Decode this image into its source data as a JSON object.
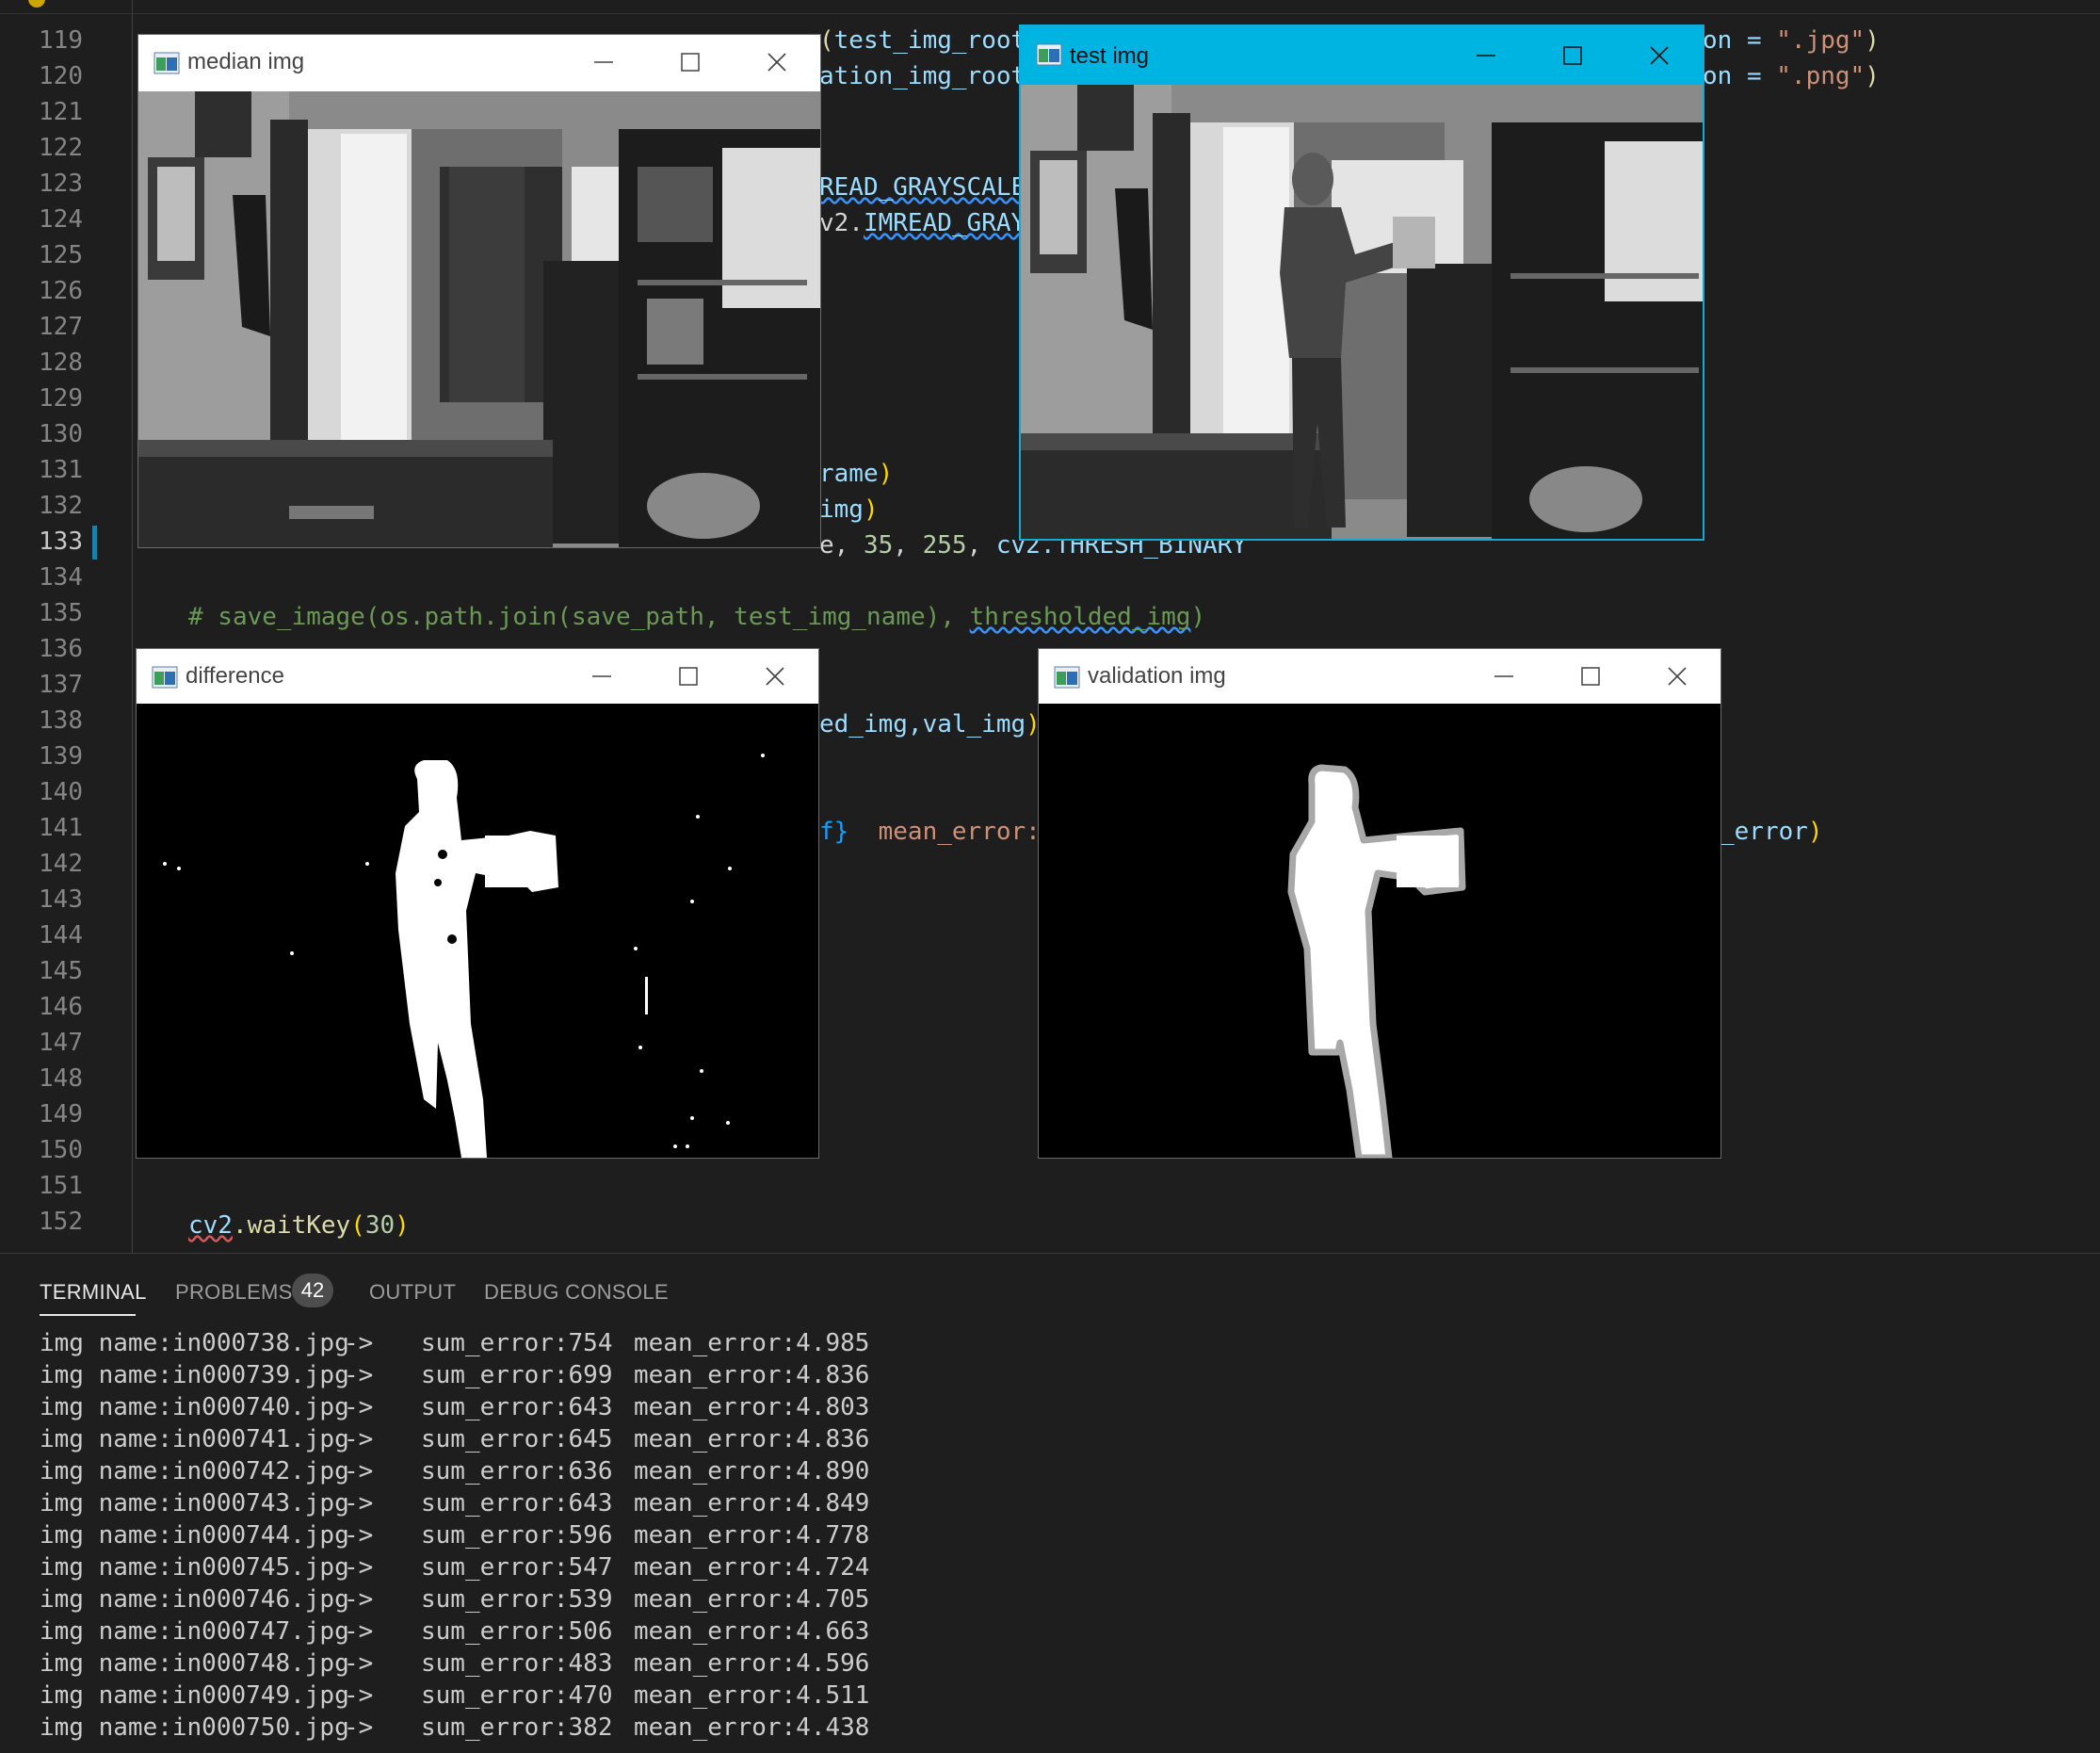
{
  "editor": {
    "line_numbers": [
      "119",
      "120",
      "121",
      "122",
      "123",
      "124",
      "125",
      "126",
      "127",
      "128",
      "129",
      "130",
      "131",
      "132",
      "133",
      "134",
      "135",
      "136",
      "137",
      "138",
      "139",
      "140",
      "141",
      "142",
      "143",
      "144",
      "145",
      "146",
      "147",
      "148",
      "149",
      "150",
      "151",
      "152"
    ],
    "active_line": "133",
    "fragments": {
      "l119a": "test_img_root",
      "l119b": "on = ",
      "l119c": "\".jpg\"",
      "l120a": "ation_img_root",
      "l120b": "on = ",
      "l120c": "\".png\"",
      "l123": "READ_GRAYSCALE",
      "l124a": "v2.",
      "l124b": "IMREAD_GRAY",
      "l131": "rame",
      "l132": "img",
      "l133a": "e, ",
      "l133b": "35",
      "l133c": "255",
      "l133d": "cv2.THRESH_BINARY",
      "l135_comment": "# save_image(os.path.join(save_path, test_img_name), ",
      "l135_var": "thresholded_img",
      "l138": "ed_img,val_img",
      "l141a": "f}",
      "l141b": "mean_error:",
      "l141c": "_error",
      "l152a": "cv2",
      "l152b": ".waitKey",
      "l152c": "30"
    }
  },
  "windows": {
    "median": {
      "title": "median img"
    },
    "test": {
      "title": "test img"
    },
    "difference": {
      "title": "difference"
    },
    "validation": {
      "title": "validation img"
    }
  },
  "panel": {
    "tabs": [
      "TERMINAL",
      "PROBLEMS",
      "OUTPUT",
      "DEBUG CONSOLE"
    ],
    "active_tab": "TERMINAL",
    "problems_count": "42",
    "terminal_rows": [
      {
        "name": "img name:in000738.jpg",
        "arrow": "->",
        "sum": "sum_error:754",
        "mean": "mean_error:4.985"
      },
      {
        "name": "img name:in000739.jpg",
        "arrow": "->",
        "sum": "sum_error:699",
        "mean": "mean_error:4.836"
      },
      {
        "name": "img name:in000740.jpg",
        "arrow": "->",
        "sum": "sum_error:643",
        "mean": "mean_error:4.803"
      },
      {
        "name": "img name:in000741.jpg",
        "arrow": "->",
        "sum": "sum_error:645",
        "mean": "mean_error:4.836"
      },
      {
        "name": "img name:in000742.jpg",
        "arrow": "->",
        "sum": "sum_error:636",
        "mean": "mean_error:4.890"
      },
      {
        "name": "img name:in000743.jpg",
        "arrow": "->",
        "sum": "sum_error:643",
        "mean": "mean_error:4.849"
      },
      {
        "name": "img name:in000744.jpg",
        "arrow": "->",
        "sum": "sum_error:596",
        "mean": "mean_error:4.778"
      },
      {
        "name": "img name:in000745.jpg",
        "arrow": "->",
        "sum": "sum_error:547",
        "mean": "mean_error:4.724"
      },
      {
        "name": "img name:in000746.jpg",
        "arrow": "->",
        "sum": "sum_error:539",
        "mean": "mean_error:4.705"
      },
      {
        "name": "img name:in000747.jpg",
        "arrow": "->",
        "sum": "sum_error:506",
        "mean": "mean_error:4.663"
      },
      {
        "name": "img name:in000748.jpg",
        "arrow": "->",
        "sum": "sum_error:483",
        "mean": "mean_error:4.596"
      },
      {
        "name": "img name:in000749.jpg",
        "arrow": "->",
        "sum": "sum_error:470",
        "mean": "mean_error:4.511"
      },
      {
        "name": "img name:in000750.jpg",
        "arrow": "->",
        "sum": "sum_error:382",
        "mean": "mean_error:4.438"
      }
    ]
  }
}
